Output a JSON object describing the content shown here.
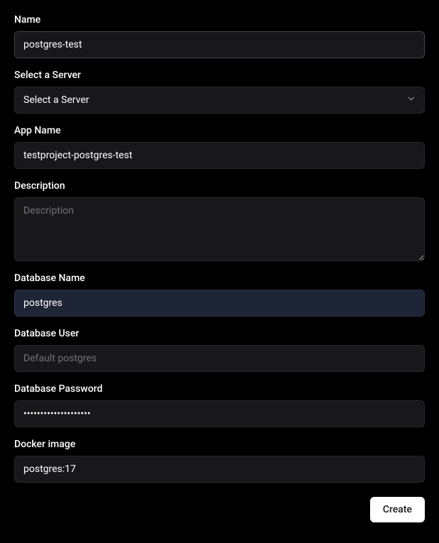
{
  "form": {
    "name": {
      "label": "Name",
      "value": "postgres-test"
    },
    "server": {
      "label": "Select a Server",
      "placeholder": "Select a Server"
    },
    "appName": {
      "label": "App Name",
      "value": "testproject-postgres-test"
    },
    "description": {
      "label": "Description",
      "placeholder": "Description"
    },
    "databaseName": {
      "label": "Database Name",
      "value": "postgres"
    },
    "databaseUser": {
      "label": "Database User",
      "placeholder": "Default postgres"
    },
    "databasePassword": {
      "label": "Database Password",
      "value": "••••••••••••••••••••"
    },
    "dockerImage": {
      "label": "Docker image",
      "value": "postgres:17"
    }
  },
  "actions": {
    "create_label": "Create"
  }
}
